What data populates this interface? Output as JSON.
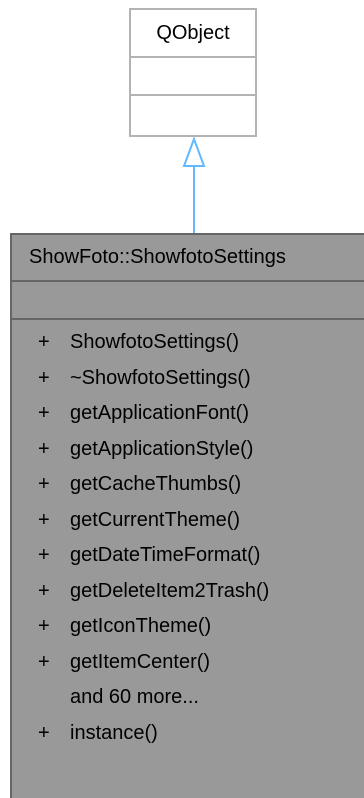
{
  "base_class": {
    "name": "QObject"
  },
  "derived_class": {
    "name": "ShowFoto::ShowfotoSettings",
    "members": [
      {
        "visibility": "+",
        "name": "ShowfotoSettings()"
      },
      {
        "visibility": "+",
        "name": "~ShowfotoSettings()"
      },
      {
        "visibility": "+",
        "name": "getApplicationFont()"
      },
      {
        "visibility": "+",
        "name": "getApplicationStyle()"
      },
      {
        "visibility": "+",
        "name": "getCacheThumbs()"
      },
      {
        "visibility": "+",
        "name": "getCurrentTheme()"
      },
      {
        "visibility": "+",
        "name": "getDateTimeFormat()"
      },
      {
        "visibility": "+",
        "name": "getDeleteItem2Trash()"
      },
      {
        "visibility": "+",
        "name": "getIconTheme()"
      },
      {
        "visibility": "+",
        "name": "getItemCenter()"
      },
      {
        "visibility": "",
        "name": "and 60 more..."
      },
      {
        "visibility": "+",
        "name": "instance()"
      }
    ]
  },
  "colors": {
    "base_border": "#b3b3b3",
    "derived_fill": "#999999",
    "derived_border": "#666666",
    "arrow": "#63b8ff"
  }
}
